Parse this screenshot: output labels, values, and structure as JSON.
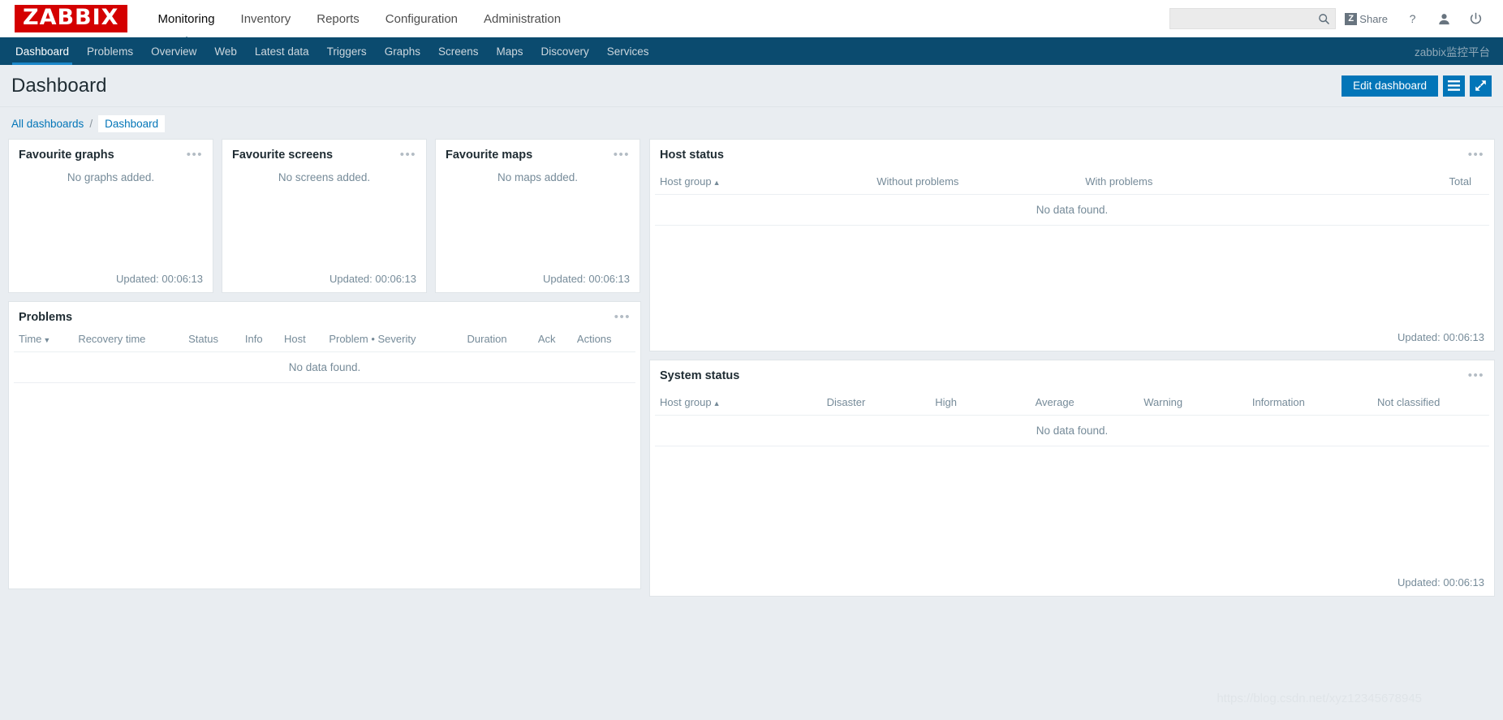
{
  "header": {
    "logo_text": "ZABBIX",
    "menu": [
      {
        "label": "Monitoring",
        "active": true
      },
      {
        "label": "Inventory",
        "active": false
      },
      {
        "label": "Reports",
        "active": false
      },
      {
        "label": "Configuration",
        "active": false
      },
      {
        "label": "Administration",
        "active": false
      }
    ],
    "search": {
      "value": "",
      "placeholder": ""
    },
    "share_label": "Share",
    "share_badge": "Z",
    "icons": [
      "help-icon",
      "user-icon",
      "power-icon"
    ]
  },
  "subnav": {
    "items": [
      {
        "label": "Dashboard",
        "active": true
      },
      {
        "label": "Problems",
        "active": false
      },
      {
        "label": "Overview",
        "active": false
      },
      {
        "label": "Web",
        "active": false
      },
      {
        "label": "Latest data",
        "active": false
      },
      {
        "label": "Triggers",
        "active": false
      },
      {
        "label": "Graphs",
        "active": false
      },
      {
        "label": "Screens",
        "active": false
      },
      {
        "label": "Maps",
        "active": false
      },
      {
        "label": "Discovery",
        "active": false
      },
      {
        "label": "Services",
        "active": false
      }
    ],
    "right_label": "zabbix监控平台"
  },
  "page": {
    "title": "Dashboard",
    "edit_button": "Edit dashboard",
    "menu_icon": "hamburger-icon",
    "fullscreen_icon": "expand-icon"
  },
  "breadcrumb": {
    "root": "All dashboards",
    "separator": "/",
    "current": "Dashboard"
  },
  "widgets": {
    "favourite_graphs": {
      "title": "Favourite graphs",
      "empty": "No graphs added.",
      "updated": "Updated: 00:06:13"
    },
    "favourite_screens": {
      "title": "Favourite screens",
      "empty": "No screens added.",
      "updated": "Updated: 00:06:13"
    },
    "favourite_maps": {
      "title": "Favourite maps",
      "empty": "No maps added.",
      "updated": "Updated: 00:06:13"
    },
    "problems": {
      "title": "Problems",
      "columns": [
        "Time",
        "Recovery time",
        "Status",
        "Info",
        "Host",
        "Problem • Severity",
        "Duration",
        "Ack",
        "Actions"
      ],
      "sort_column": "Time",
      "sort_arrow": "▼",
      "empty": "No data found."
    },
    "host_status": {
      "title": "Host status",
      "columns": [
        "Host group",
        "Without problems",
        "With problems",
        "Total"
      ],
      "sort_column": "Host group",
      "sort_arrow": "▲",
      "empty": "No data found.",
      "updated": "Updated: 00:06:13"
    },
    "system_status": {
      "title": "System status",
      "columns": [
        "Host group",
        "Disaster",
        "High",
        "Average",
        "Warning",
        "Information",
        "Not classified"
      ],
      "sort_column": "Host group",
      "sort_arrow": "▲",
      "empty": "No data found.",
      "updated": "Updated: 00:06:13"
    }
  },
  "watermark": "https://blog.csdn.net/xyz12345678945",
  "colors": {
    "brand_red": "#d40000",
    "nav_dark": "#0b4b6f",
    "accent_blue": "#0275b8",
    "page_bg": "#e9edf1"
  }
}
